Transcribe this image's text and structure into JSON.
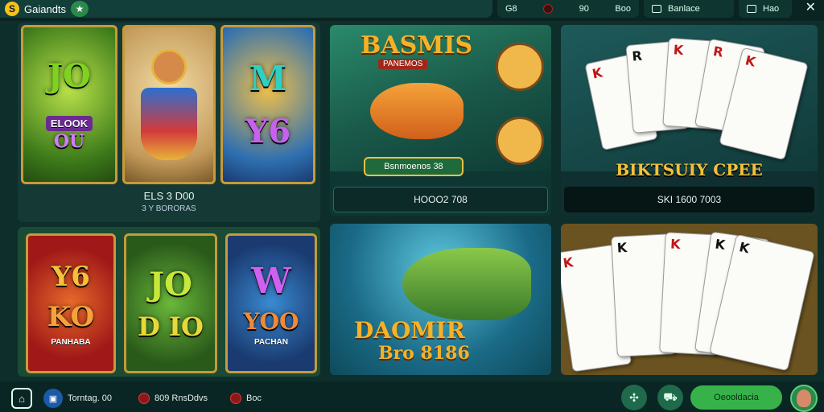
{
  "header": {
    "brand_logo": "S",
    "brand_name": "Gaiandts",
    "pill1": {
      "left": "G8",
      "mid": "90",
      "right": "Boo"
    },
    "pill2_label": "Banlace",
    "pill3_label": "Hao",
    "close_glyph": "✕"
  },
  "slots_top": {
    "tiles": [
      {
        "text1": "JO",
        "text2": "ELOOK",
        "text3": "OU"
      },
      {
        "text1": ""
      },
      {
        "text1": "M",
        "text2": "Y6"
      }
    ],
    "caption": "ELS 3 D00",
    "subcaption": "3 Y BORORAS"
  },
  "slots_bottom": {
    "tiles": [
      {
        "text1": "Y6",
        "text2": "KO",
        "text3": "PANHABA"
      },
      {
        "text1": "JO",
        "text2": "D IO"
      },
      {
        "text1": "W",
        "text2": "YOO",
        "text3": "PACHAN"
      }
    ]
  },
  "fish_top": {
    "title": "BASMIS",
    "subtitle": "PANEMOS",
    "button": "Bsnmoenos 38",
    "bar": "HOOO2 708"
  },
  "cards_top": {
    "title": "BIKTSUIY CPEE",
    "bar": "SKI 1600 7003",
    "cards": [
      "K",
      "R",
      "K",
      "R",
      "K"
    ]
  },
  "fish_bottom": {
    "title": "DAOMIR",
    "subtitle": "Bro 8186"
  },
  "cards_bottom": {
    "cards": [
      "K",
      "K",
      "K",
      "K",
      "K"
    ]
  },
  "footer": {
    "home_icon": "home",
    "user_label": "Torntag. 00",
    "item2": "809 RnsDdvs",
    "item3": "Boc",
    "cta": "Oeooldacia",
    "colors": {
      "cta": "#37b24a",
      "bar": "#0a2624"
    }
  }
}
